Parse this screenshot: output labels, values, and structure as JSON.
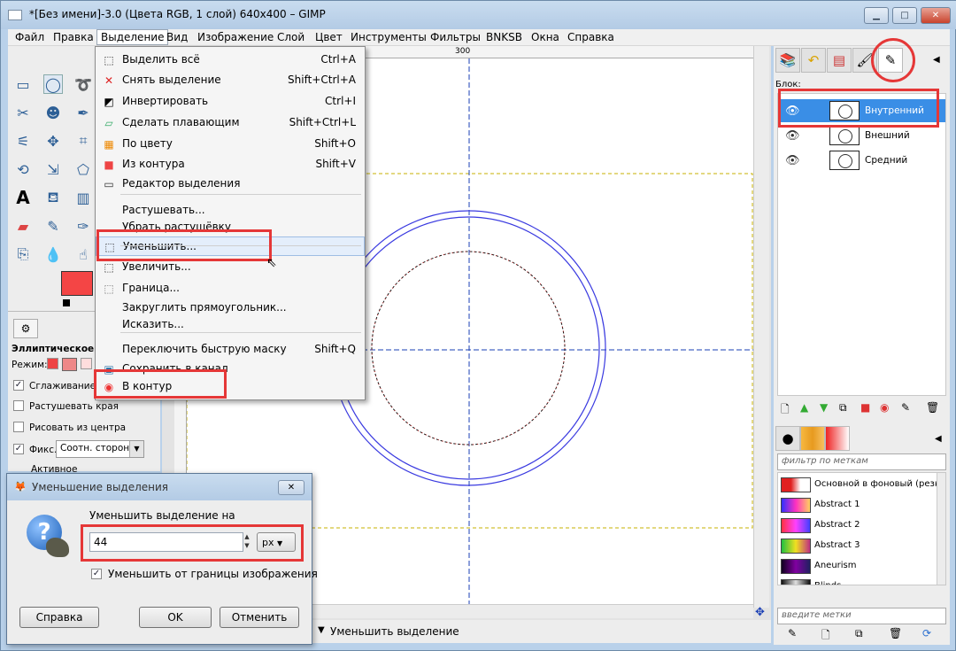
{
  "window": {
    "title": "*[Без имени]-3.0 (Цвета RGB, 1 слой) 640x400 – GIMP",
    "buttons": {
      "minimize": "▁",
      "maximize": "□",
      "close": "✕"
    }
  },
  "menubar": [
    "Файл",
    "Правка",
    "Выделение",
    "Вид",
    "Изображение",
    "Слой",
    "Цвет",
    "Инструменты",
    "Фильтры",
    "BNKSB",
    "Окна",
    "Справка"
  ],
  "select_menu": {
    "items": [
      {
        "label": "Выделить всё",
        "shortcut": "Ctrl+A",
        "icon": "select-all-icon"
      },
      {
        "label": "Снять выделение",
        "shortcut": "Shift+Ctrl+A",
        "icon": "select-none-icon"
      },
      {
        "label": "Инвертировать",
        "shortcut": "Ctrl+I",
        "icon": "invert-icon"
      },
      {
        "label": "Сделать плавающим",
        "shortcut": "Shift+Ctrl+L",
        "icon": "float-icon"
      },
      {
        "label": "По цвету",
        "shortcut": "Shift+O",
        "icon": "by-color-icon"
      },
      {
        "label": "Из контура",
        "shortcut": "Shift+V",
        "icon": "from-path-icon"
      },
      {
        "label": "Редактор выделения",
        "shortcut": "",
        "icon": "selection-editor-icon"
      },
      {
        "label": "Растушевать...",
        "shortcut": "",
        "icon": ""
      },
      {
        "label": "Убрать растушёвку",
        "shortcut": "",
        "icon": ""
      },
      {
        "label": "Уменьшить...",
        "shortcut": "",
        "icon": "shrink-icon"
      },
      {
        "label": "Увеличить...",
        "shortcut": "",
        "icon": "grow-icon"
      },
      {
        "label": "Граница...",
        "shortcut": "",
        "icon": "border-icon"
      },
      {
        "label": "Закруглить прямоугольник...",
        "shortcut": "",
        "icon": ""
      },
      {
        "label": "Исказить...",
        "shortcut": "",
        "icon": ""
      },
      {
        "label": "Переключить быструю маску",
        "shortcut": "Shift+Q",
        "icon": ""
      },
      {
        "label": "Сохранить в канал",
        "shortcut": "",
        "icon": "save-channel-icon"
      },
      {
        "label": "В контур",
        "shortcut": "",
        "icon": "to-path-icon"
      }
    ]
  },
  "tool_options": {
    "title": "Эллиптическое выд",
    "mode_label": "Режим:",
    "antialias": "Сглаживание",
    "feather": "Растушевать края",
    "from_center": "Рисовать из центра",
    "fixed": "Фикс.:",
    "fixed_value": "Соотн. сторон",
    "active": "Активное"
  },
  "ruler": {
    "mark_300": "300"
  },
  "status": {
    "unit_arrow": "▼",
    "text": "Уменьшить выделение"
  },
  "dock": {
    "lock_label": "Блок:",
    "layers": [
      {
        "name": "Внутренний",
        "selected": true
      },
      {
        "name": "Внешний",
        "selected": false
      },
      {
        "name": "Средний",
        "selected": false
      }
    ],
    "gradient_filter_placeholder": "фильтр по меткам",
    "tags_placeholder": "введите метки",
    "gradients": [
      {
        "name": "Основной в фоновый (резк",
        "colors": [
          "#e02020",
          "#e02020",
          "#ffffff",
          "#ffffff"
        ]
      },
      {
        "name": "Abstract 1",
        "colors": [
          "#3030ff",
          "#ff30c0",
          "#ffd060"
        ]
      },
      {
        "name": "Abstract 2",
        "colors": [
          "#ff3040",
          "#ff40ff",
          "#4040ff"
        ]
      },
      {
        "name": "Abstract 3",
        "colors": [
          "#20c040",
          "#f0e020",
          "#c03080"
        ]
      },
      {
        "name": "Aneurism",
        "colors": [
          "#100020",
          "#8000a0",
          "#202060"
        ]
      },
      {
        "name": "Blinds",
        "colors": [
          "#101010",
          "#e0e0e0",
          "#101010"
        ]
      }
    ]
  },
  "dialog": {
    "title": "Уменьшение выделения",
    "close": "✕",
    "prompt": "Уменьшить выделение на",
    "value": "44",
    "unit": "px",
    "checkbox_label": "Уменьшить от границы изображения",
    "checkbox_checked": true,
    "help": "Справка",
    "ok": "OK",
    "cancel": "Отменить"
  },
  "colors": {
    "highlight_red": "#e53737",
    "selected_layer": "#3a8ee6",
    "foreground": "#f44545"
  }
}
